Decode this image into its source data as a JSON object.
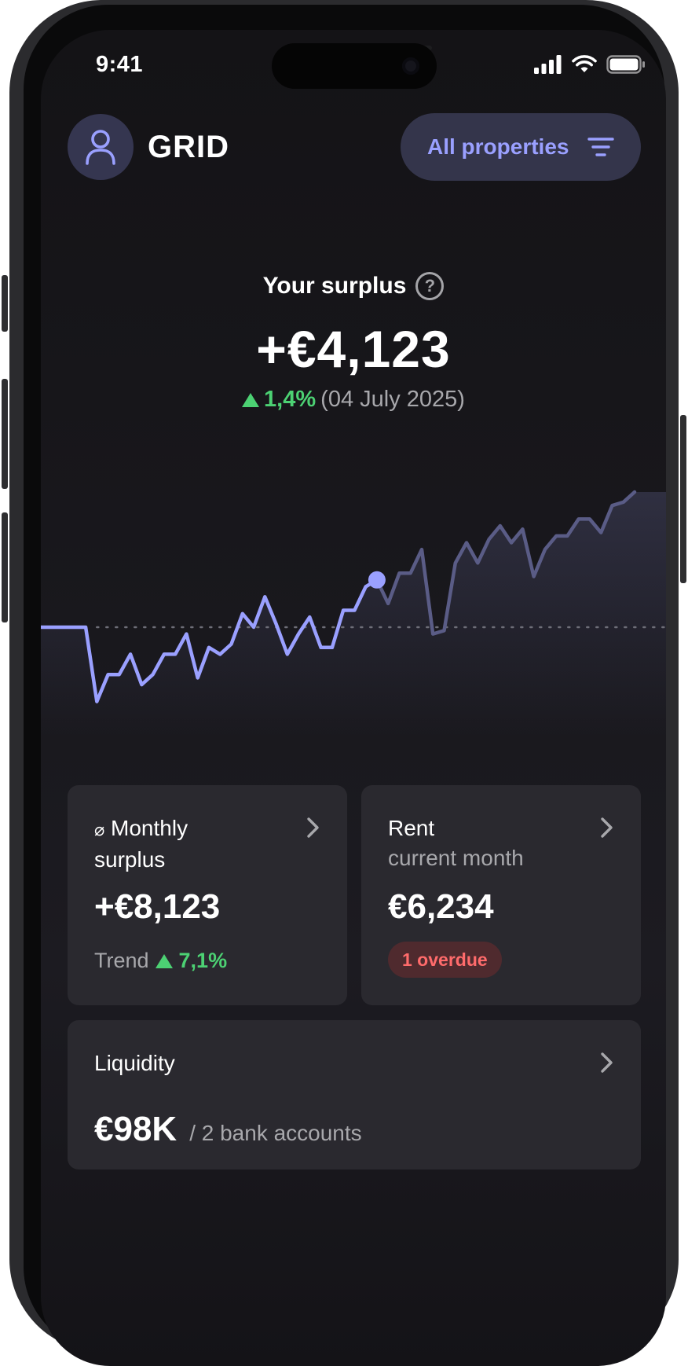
{
  "status": {
    "time": "9:41"
  },
  "header": {
    "brand": "GRID",
    "filter_label": "All properties"
  },
  "surplus": {
    "label": "Your surplus",
    "value": "+€4,123",
    "change": "1,4%",
    "date": "(04 July 2025)"
  },
  "chart_data": {
    "type": "line",
    "values": [
      0,
      0,
      0,
      0,
      0,
      -22,
      -14,
      -14,
      -8,
      -17,
      -14,
      -8,
      -8,
      -2,
      -15,
      -6,
      -8,
      -5,
      4,
      0,
      9,
      1,
      -8,
      -2,
      3,
      -6,
      -6,
      5,
      5,
      12,
      14,
      7,
      16,
      16,
      23,
      -2,
      -1,
      19,
      25,
      19,
      26,
      30,
      25,
      29,
      15,
      23,
      27,
      27,
      32,
      32,
      28,
      36,
      37,
      40
    ],
    "highlight_index": 30,
    "baseline": 0,
    "colors": {
      "past": "#9aa0ff",
      "future": "#5a5c86",
      "dot": "#9aa0ff",
      "baseline": "#6e6e78"
    }
  },
  "cards": {
    "monthly": {
      "symbol": "⌀",
      "title": "Monthly",
      "title2": "surplus",
      "value": "+€8,123",
      "trend_label": "Trend",
      "trend_value": "7,1%"
    },
    "rent": {
      "title": "Rent",
      "subtitle": "current month",
      "value": "€6,234",
      "badge": "1 overdue"
    },
    "liquidity": {
      "title": "Liquidity",
      "value": "€98K",
      "detail": "/ 2 bank accounts"
    }
  }
}
